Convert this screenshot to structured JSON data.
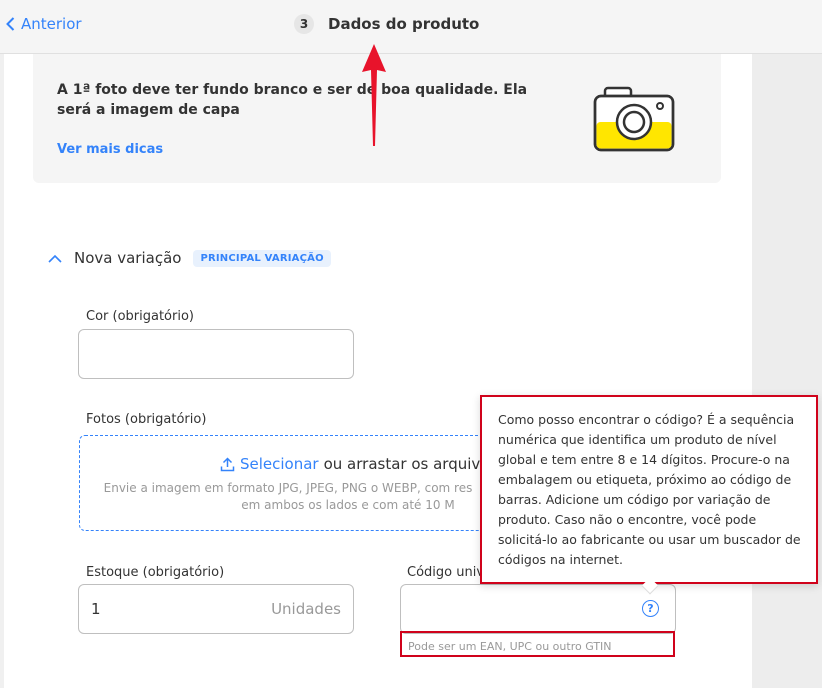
{
  "header": {
    "back_label": "Anterior",
    "step_number": "3",
    "step_title": "Dados do produto"
  },
  "tip": {
    "text": "A 1ª foto deve ter fundo branco e ser de boa qualidade. Ela será a imagem de capa",
    "link": "Ver mais dicas"
  },
  "variation": {
    "title": "Nova variação",
    "badge": "PRINCIPAL VARIAÇÃO"
  },
  "fields": {
    "color_label": "Cor (obrigatório)",
    "color_value": "",
    "photos_label": "Fotos (obrigatório)",
    "upload_select": "Selecionar",
    "upload_rest": "ou arrastar os arquivos",
    "upload_help_1": "Envie a imagem em formato JPG, JPEG, PNG o WEBP, com res",
    "upload_help_2": "em ambos os lados e com até 10 M",
    "stock_label": "Estoque (obrigatório)",
    "stock_value": "1",
    "stock_unit": "Unidades",
    "code_label": "Código univ",
    "code_value": "",
    "code_help_symbol": "?",
    "code_hint": "Pode ser um EAN, UPC ou outro GTIN"
  },
  "tooltip": {
    "text": "Como posso encontrar o código? É a sequência numérica que identifica um produto de nível global e tem entre 8 e 14 dígitos. Procure-o na embalagem ou etiqueta, próximo ao código de barras. Adicione um código por variação de produto. Caso não o encontre, você pode solicitá-lo ao fabricante ou usar um buscador de códigos na internet."
  },
  "colors": {
    "accent": "#3483fa",
    "annotation_red": "#d0021b",
    "camera_yellow": "#ffe600"
  }
}
